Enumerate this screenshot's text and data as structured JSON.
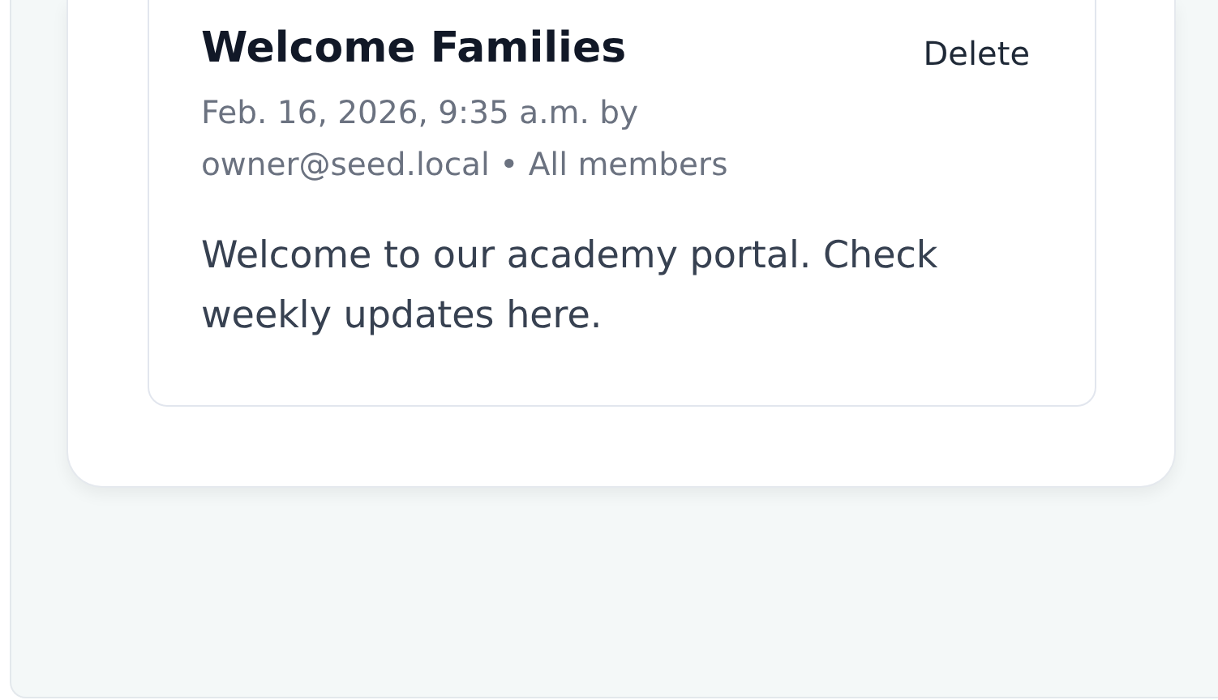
{
  "announcement": {
    "title": "Welcome Families",
    "meta": "Feb. 16, 2026, 9:35 a.m. by owner@seed.local • All members",
    "body": "Welcome to our academy portal. Check weekly updates here.",
    "delete_label": "Delete"
  }
}
